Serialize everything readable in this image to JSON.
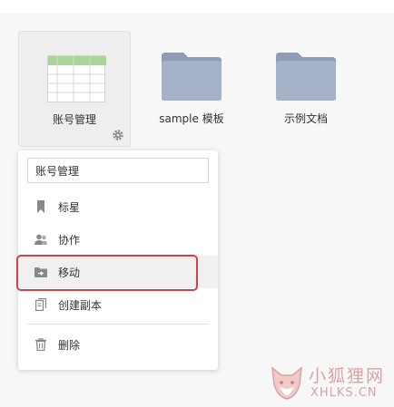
{
  "files": [
    {
      "name": "账号管理",
      "type": "spreadsheet",
      "selected": true
    },
    {
      "name": "sample 模板",
      "type": "folder"
    },
    {
      "name": "示例文档",
      "type": "folder"
    }
  ],
  "context_menu": {
    "rename_value": "账号管理",
    "items": [
      {
        "label": "标星",
        "icon": "bookmark-icon"
      },
      {
        "label": "协作",
        "icon": "users-icon"
      },
      {
        "label": "移动",
        "icon": "move-folder-icon",
        "active": true
      },
      {
        "label": "创建副本",
        "icon": "copy-icon"
      },
      {
        "label": "删除",
        "icon": "trash-icon"
      }
    ]
  },
  "watermark": {
    "text_cn": "小狐狸网",
    "text_en": "XHLKS.CN"
  },
  "colors": {
    "folder": "#9aa7bd",
    "highlight": "#d1424b",
    "sheet_header": "#a9d49a",
    "watermark": "#d9a3a3"
  }
}
